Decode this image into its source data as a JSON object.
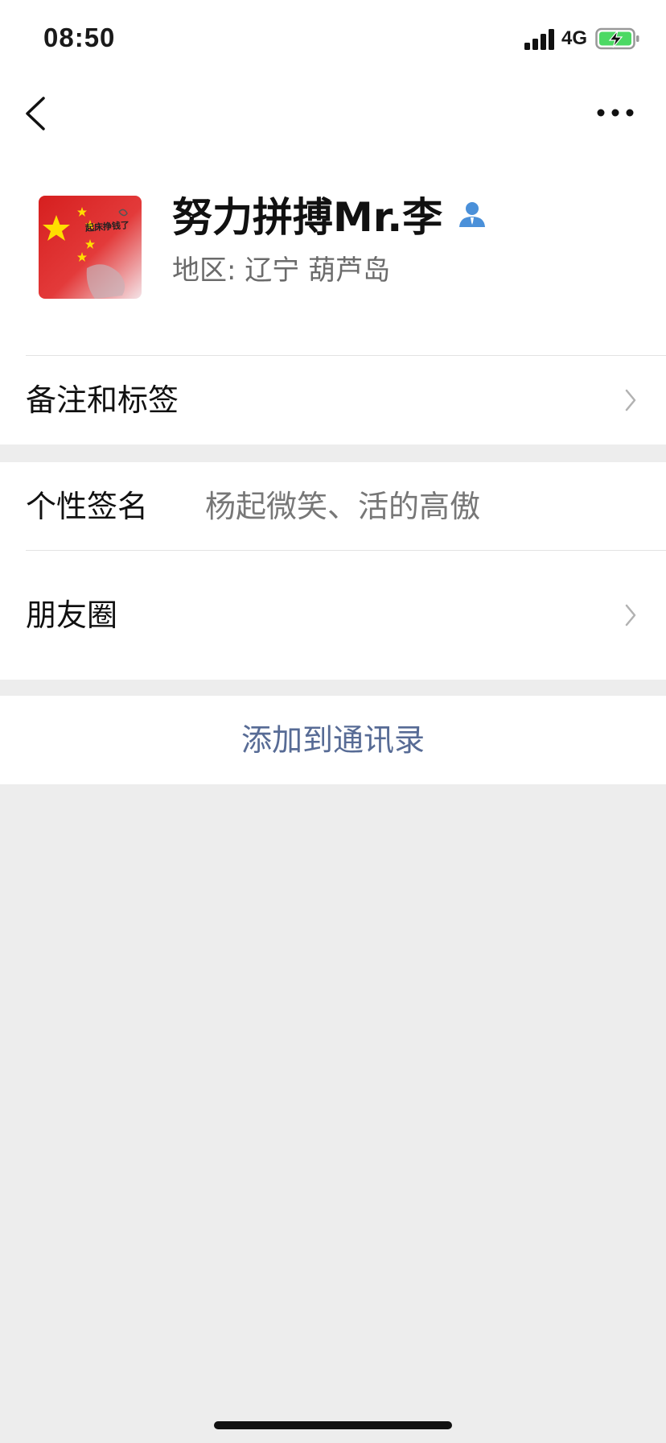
{
  "status_bar": {
    "time": "08:50",
    "network": "4G",
    "icons": [
      "signal-icon",
      "battery-charging-icon"
    ]
  },
  "nav": {
    "icons": [
      "back-icon",
      "more-icon"
    ]
  },
  "profile": {
    "name": "努力拼搏Mr.李",
    "region": "地区: 辽宁 葫芦岛",
    "avatar_text": "起床挣钱了",
    "icons": [
      "person-icon"
    ]
  },
  "rows": {
    "remarks_label": "备注和标签",
    "signature_label": "个性签名",
    "signature_value": "杨起微笑、活的高傲",
    "moments_label": "朋友圈"
  },
  "actions": {
    "add_contact": "添加到通讯录"
  },
  "colors": {
    "link_blue": "#576b95",
    "background": "#ededed",
    "person_icon": "#4a90d9",
    "battery_green": "#4cd964"
  }
}
